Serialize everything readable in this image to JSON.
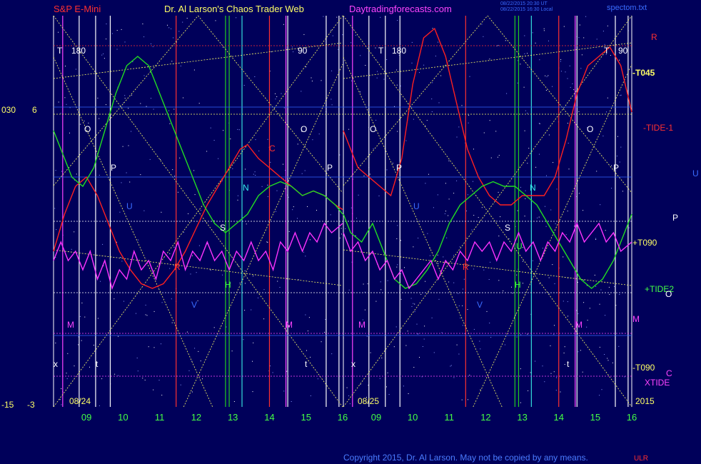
{
  "header": {
    "instrument": "S&P E-Mini",
    "title": "Dr. Al Larson's Chaos Trader Web",
    "site": "Daytradingforecasts.com",
    "stamp_1": "08/22/2015 20:30 UT",
    "stamp_2": "08/22/2015 16:30 Local",
    "file": "spectom.txt"
  },
  "footer": {
    "copyright": "Copyright 2015, Dr. Al Larson. May not be copied by any means.",
    "tag": "ULR"
  },
  "left_axis": {
    "top_a": "030",
    "top_b": "6",
    "bottom_a": "-15",
    "bottom_b": "-3"
  },
  "year": "2015",
  "days": [
    {
      "date": "08/24",
      "marker_a": "T",
      "angle": "180",
      "angle_2": "90",
      "tag_o": "O",
      "tag_q": "O",
      "tag_p1": "P",
      "tag_p2": "P",
      "tag_u": "U",
      "tag_n": "N",
      "tag_s": "S",
      "tag_h": "H",
      "tag_c": "C",
      "tag_r": "R",
      "tag_v": "V",
      "tag_m1": "M",
      "tag_m2": "M",
      "tag_t1": "t",
      "tag_t2": "t",
      "tag_x": "x"
    },
    {
      "date": "08/25",
      "marker_a": "T",
      "angle": "180",
      "angle_2": "90",
      "marker_b": "T",
      "tag_o": "O",
      "tag_q": "O",
      "tag_p1": "P",
      "tag_p2": "P",
      "tag_u": "U",
      "tag_n": "N",
      "tag_s": "S",
      "tag_h": "H",
      "tag_u2": "U",
      "tag_r": "R",
      "tag_v": "V",
      "tag_m1": "M",
      "tag_m2": "M",
      "tag_t1": "t",
      "tag_x": "x"
    }
  ],
  "right_labels": {
    "r": "R",
    "t045": "-T045",
    "tide1": "-TIDE-1",
    "u": "U",
    "p": "P",
    "t090p": "+T090",
    "tide2": "+TIDE2",
    "o": "O",
    "m": "M",
    "t090m": "-T090",
    "c": "C",
    "xtide": "XTIDE"
  },
  "chart_data": {
    "type": "line",
    "title": "S&P E-Mini",
    "x_tick_labels": [
      "09",
      "10",
      "11",
      "12",
      "13",
      "14",
      "15",
      "16",
      "09",
      "10",
      "11",
      "12",
      "13",
      "14",
      "15",
      "16"
    ],
    "x_range_hours": [
      8.1,
      16.0
    ],
    "y_labels": [
      "030",
      "6",
      "-15",
      "-3"
    ],
    "series": [
      {
        "name": "-TIDE-1",
        "color": "#ff2020",
        "panel_1": [
          [
            8.1,
            -0.4
          ],
          [
            8.4,
            0.0
          ],
          [
            8.7,
            0.3
          ],
          [
            9.0,
            0.4
          ],
          [
            9.3,
            0.2
          ],
          [
            9.6,
            -0.1
          ],
          [
            9.9,
            -0.4
          ],
          [
            10.2,
            -0.6
          ],
          [
            10.5,
            -0.75
          ],
          [
            10.8,
            -0.8
          ],
          [
            11.1,
            -0.75
          ],
          [
            11.4,
            -0.6
          ],
          [
            11.7,
            -0.4
          ],
          [
            12.0,
            -0.15
          ],
          [
            12.3,
            0.1
          ],
          [
            12.6,
            0.3
          ],
          [
            12.9,
            0.5
          ],
          [
            13.2,
            0.7
          ],
          [
            13.4,
            0.75
          ],
          [
            13.7,
            0.6
          ],
          [
            14.0,
            0.5
          ],
          [
            14.3,
            0.4
          ],
          [
            14.6,
            0.3
          ],
          [
            14.9,
            0.2
          ],
          [
            15.2,
            0.25
          ],
          [
            15.5,
            0.2
          ],
          [
            15.8,
            0.1
          ],
          [
            16.0,
            0.05
          ]
        ],
        "panel_2": [
          [
            8.1,
            0.9
          ],
          [
            8.3,
            0.7
          ],
          [
            8.5,
            0.5
          ],
          [
            8.8,
            0.4
          ],
          [
            9.1,
            0.3
          ],
          [
            9.4,
            0.2
          ],
          [
            9.7,
            0.6
          ],
          [
            10.0,
            1.4
          ],
          [
            10.3,
            1.9
          ],
          [
            10.6,
            2.0
          ],
          [
            10.9,
            1.7
          ],
          [
            11.2,
            1.2
          ],
          [
            11.5,
            0.7
          ],
          [
            11.8,
            0.4
          ],
          [
            12.1,
            0.2
          ],
          [
            12.4,
            0.1
          ],
          [
            12.7,
            0.1
          ],
          [
            13.0,
            0.2
          ],
          [
            13.3,
            0.2
          ],
          [
            13.6,
            0.2
          ],
          [
            13.9,
            0.4
          ],
          [
            14.2,
            0.8
          ],
          [
            14.5,
            1.3
          ],
          [
            14.8,
            1.6
          ],
          [
            15.1,
            1.7
          ],
          [
            15.4,
            1.8
          ],
          [
            15.7,
            1.6
          ],
          [
            16.0,
            1.1
          ]
        ]
      },
      {
        "name": "+TIDE2",
        "color": "#22dd22",
        "panel_1": [
          [
            8.1,
            0.9
          ],
          [
            8.3,
            0.7
          ],
          [
            8.6,
            0.4
          ],
          [
            8.9,
            0.3
          ],
          [
            9.2,
            0.5
          ],
          [
            9.5,
            0.9
          ],
          [
            9.8,
            1.3
          ],
          [
            10.1,
            1.6
          ],
          [
            10.4,
            1.7
          ],
          [
            10.7,
            1.6
          ],
          [
            11.0,
            1.3
          ],
          [
            11.3,
            1.0
          ],
          [
            11.6,
            0.7
          ],
          [
            11.9,
            0.4
          ],
          [
            12.2,
            0.1
          ],
          [
            12.5,
            -0.1
          ],
          [
            12.8,
            -0.2
          ],
          [
            13.1,
            -0.1
          ],
          [
            13.4,
            0.0
          ],
          [
            13.7,
            0.2
          ],
          [
            14.0,
            0.3
          ],
          [
            14.3,
            0.35
          ],
          [
            14.6,
            0.3
          ],
          [
            14.9,
            0.2
          ],
          [
            15.2,
            0.25
          ],
          [
            15.5,
            0.2
          ],
          [
            15.8,
            0.1
          ],
          [
            16.0,
            0.0
          ]
        ],
        "panel_2": [
          [
            8.1,
            0.0
          ],
          [
            8.3,
            -0.2
          ],
          [
            8.6,
            -0.3
          ],
          [
            8.9,
            -0.1
          ],
          [
            9.2,
            -0.4
          ],
          [
            9.5,
            -0.7
          ],
          [
            9.8,
            -0.8
          ],
          [
            10.1,
            -0.75
          ],
          [
            10.4,
            -0.6
          ],
          [
            10.7,
            -0.4
          ],
          [
            11.0,
            -0.1
          ],
          [
            11.3,
            0.1
          ],
          [
            11.6,
            0.2
          ],
          [
            11.9,
            0.3
          ],
          [
            12.2,
            0.35
          ],
          [
            12.5,
            0.3
          ],
          [
            12.8,
            0.3
          ],
          [
            13.1,
            0.2
          ],
          [
            13.4,
            0.1
          ],
          [
            13.7,
            -0.1
          ],
          [
            14.0,
            -0.3
          ],
          [
            14.3,
            -0.5
          ],
          [
            14.6,
            -0.7
          ],
          [
            14.9,
            -0.8
          ],
          [
            15.2,
            -0.7
          ],
          [
            15.5,
            -0.5
          ],
          [
            15.8,
            -0.2
          ],
          [
            16.0,
            0.0
          ]
        ]
      },
      {
        "name": "XTIDE",
        "color": "#ff33ff",
        "panel_1": [
          [
            8.1,
            -0.5
          ],
          [
            8.3,
            -0.3
          ],
          [
            8.5,
            -0.5
          ],
          [
            8.7,
            -0.4
          ],
          [
            8.9,
            -0.6
          ],
          [
            9.1,
            -0.4
          ],
          [
            9.3,
            -0.7
          ],
          [
            9.5,
            -0.5
          ],
          [
            9.7,
            -0.8
          ],
          [
            9.9,
            -0.6
          ],
          [
            10.1,
            -0.7
          ],
          [
            10.3,
            -0.4
          ],
          [
            10.5,
            -0.6
          ],
          [
            10.7,
            -0.5
          ],
          [
            10.9,
            -0.7
          ],
          [
            11.1,
            -0.4
          ],
          [
            11.3,
            -0.5
          ],
          [
            11.5,
            -0.3
          ],
          [
            11.7,
            -0.6
          ],
          [
            11.9,
            -0.4
          ],
          [
            12.1,
            -0.5
          ],
          [
            12.3,
            -0.3
          ],
          [
            12.5,
            -0.5
          ],
          [
            12.7,
            -0.4
          ],
          [
            12.9,
            -0.6
          ],
          [
            13.1,
            -0.4
          ],
          [
            13.3,
            -0.5
          ],
          [
            13.5,
            -0.3
          ],
          [
            13.7,
            -0.5
          ],
          [
            13.9,
            -0.4
          ],
          [
            14.1,
            -0.6
          ],
          [
            14.3,
            -0.3
          ],
          [
            14.5,
            -0.4
          ],
          [
            14.7,
            -0.2
          ],
          [
            14.9,
            -0.4
          ],
          [
            15.1,
            -0.2
          ],
          [
            15.3,
            -0.3
          ],
          [
            15.5,
            -0.1
          ],
          [
            15.7,
            -0.2
          ],
          [
            16.0,
            -0.1
          ]
        ],
        "panel_2": [
          [
            8.1,
            -0.2
          ],
          [
            8.3,
            -0.4
          ],
          [
            8.5,
            -0.3
          ],
          [
            8.7,
            -0.5
          ],
          [
            8.9,
            -0.4
          ],
          [
            9.1,
            -0.6
          ],
          [
            9.3,
            -0.5
          ],
          [
            9.5,
            -0.7
          ],
          [
            9.7,
            -0.6
          ],
          [
            9.9,
            -0.8
          ],
          [
            10.1,
            -0.7
          ],
          [
            10.3,
            -0.6
          ],
          [
            10.5,
            -0.5
          ],
          [
            10.7,
            -0.7
          ],
          [
            10.9,
            -0.5
          ],
          [
            11.1,
            -0.6
          ],
          [
            11.3,
            -0.4
          ],
          [
            11.5,
            -0.5
          ],
          [
            11.7,
            -0.3
          ],
          [
            11.9,
            -0.4
          ],
          [
            12.1,
            -0.3
          ],
          [
            12.3,
            -0.5
          ],
          [
            12.5,
            -0.3
          ],
          [
            12.7,
            -0.4
          ],
          [
            12.9,
            -0.2
          ],
          [
            13.1,
            -0.4
          ],
          [
            13.3,
            -0.3
          ],
          [
            13.5,
            -0.5
          ],
          [
            13.7,
            -0.3
          ],
          [
            13.9,
            -0.4
          ],
          [
            14.1,
            -0.2
          ],
          [
            14.3,
            -0.3
          ],
          [
            14.5,
            -0.1
          ],
          [
            14.7,
            -0.3
          ],
          [
            14.9,
            -0.2
          ],
          [
            15.1,
            -0.1
          ],
          [
            15.3,
            -0.3
          ],
          [
            15.5,
            -0.2
          ],
          [
            15.7,
            -0.4
          ],
          [
            16.0,
            -0.3
          ]
        ]
      }
    ],
    "legend": "right",
    "grid": "on"
  },
  "colors": {
    "bg": "#00005a",
    "grid_red": "#ff3030",
    "grid_yellow": "#ffff66",
    "grid_white": "#ffffff",
    "grid_green": "#22cc22",
    "grid_cyan": "#33dddd",
    "grid_magenta": "#ff44ff",
    "grid_blue": "#3366ff",
    "red_text": "#ff4040",
    "magenta_text": "#ff44ff",
    "yellow_text": "#ffff66",
    "white_text": "#ffffff",
    "blue_text": "#3a6cff",
    "green_text": "#44ff44",
    "cyan_text": "#33eeee"
  }
}
